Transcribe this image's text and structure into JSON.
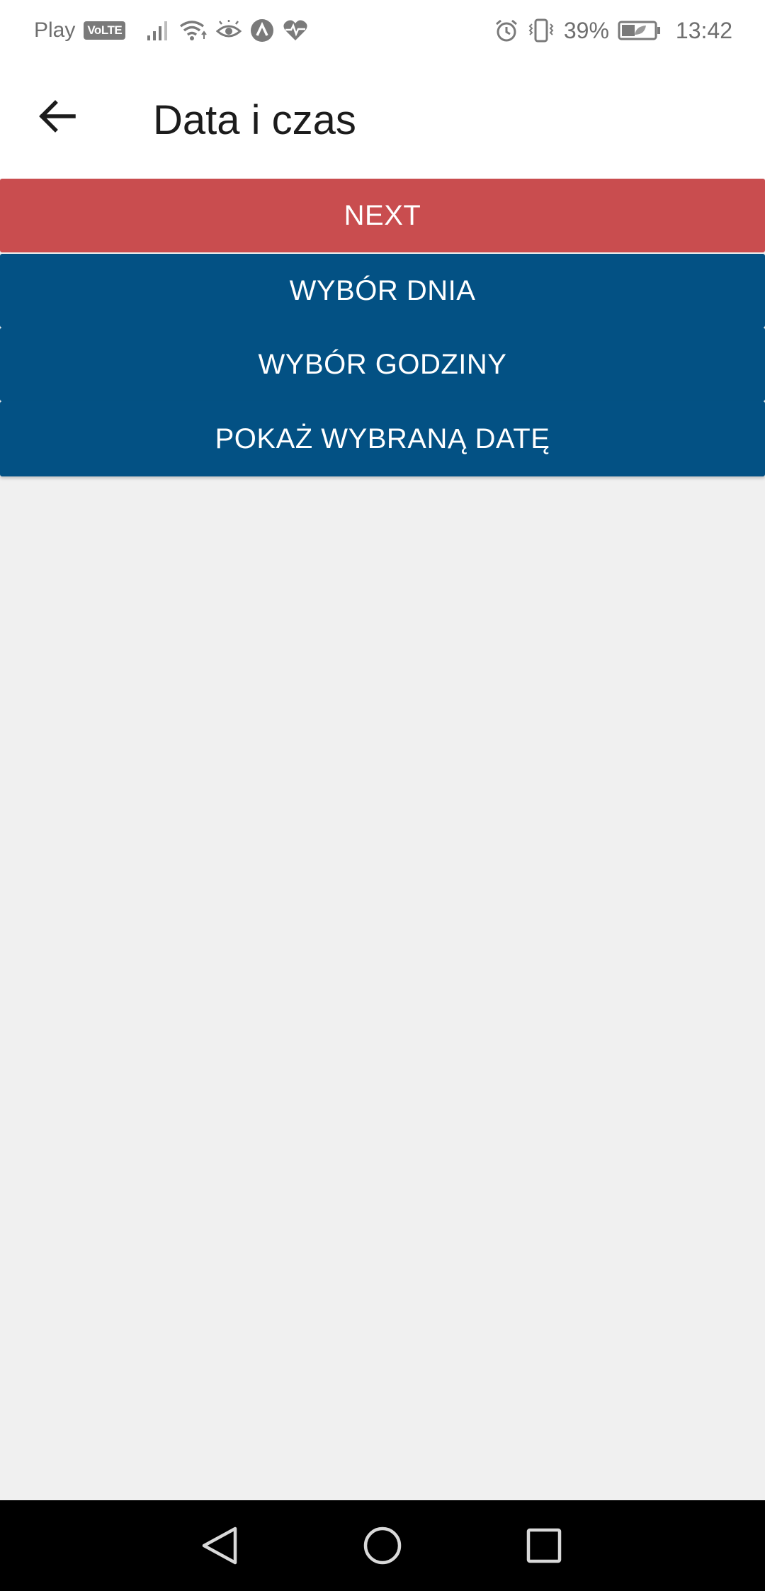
{
  "status_bar": {
    "carrier": "Play",
    "volte": "VoLTE",
    "battery_percent": "39%",
    "time": "13:42",
    "icons": [
      "signal-icon",
      "wifi-icon",
      "eye-icon",
      "arrow-app-icon",
      "heart-health-icon",
      "alarm-icon",
      "vibrate-icon",
      "battery-icon"
    ]
  },
  "app_bar": {
    "title": "Data i czas",
    "back_icon": "arrow-back-icon"
  },
  "buttons": {
    "next": "NEXT",
    "pick_day": "WYBÓR DNIA",
    "pick_hour": "WYBÓR GODZINY",
    "show_date": "POKAŻ WYBRANĄ DATĘ"
  },
  "colors": {
    "next_button": "#c94d4f",
    "primary_button": "#035184",
    "background": "#f0f0f0",
    "nav_bar": "#000000"
  },
  "nav_bar": {
    "icons": [
      "nav-back-icon",
      "nav-home-icon",
      "nav-recent-icon"
    ]
  }
}
